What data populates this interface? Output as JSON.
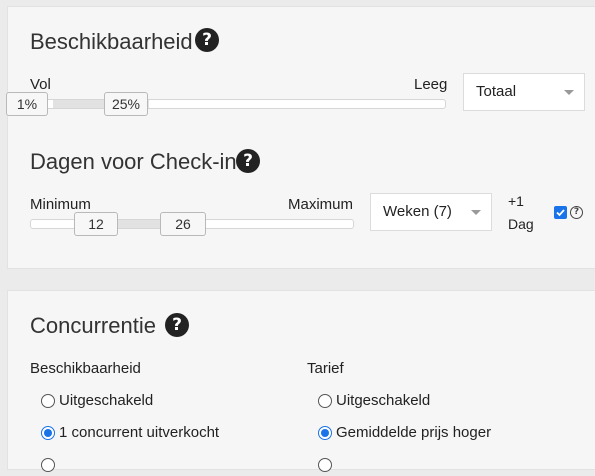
{
  "availability": {
    "title": "Beschikbaarheid",
    "help_icon": "?",
    "left_label": "Vol",
    "right_label": "Leeg",
    "handle_low": "1%",
    "handle_high": "25%",
    "range_low_fraction": 0.01,
    "range_high_fraction": 0.25,
    "select_value": "Totaal"
  },
  "checkin": {
    "title": "Dagen voor Check-in",
    "help_icon": "?",
    "left_label": "Minimum",
    "right_label": "Maximum",
    "handle_low": "12",
    "handle_high": "26",
    "select_value": "Weken (7)",
    "plus_label": "+1",
    "day_label": "Dag",
    "checkbox_checked": true,
    "small_help": "?"
  },
  "competition": {
    "title": "Concurrentie",
    "help_icon": "?",
    "availability_column": {
      "label": "Beschikbaarheid",
      "options": [
        {
          "label": "Uitgeschakeld",
          "checked": false
        },
        {
          "label": "1 concurrent uitverkocht",
          "checked": true
        }
      ]
    },
    "rate_column": {
      "label": "Tarief",
      "options": [
        {
          "label": "Uitgeschakeld",
          "checked": false
        },
        {
          "label": "Gemiddelde prijs hoger",
          "checked": true
        }
      ]
    }
  },
  "colors": {
    "accent": "#1a73e8",
    "panel": "#f6f6f6",
    "background": "#ebebeb"
  }
}
